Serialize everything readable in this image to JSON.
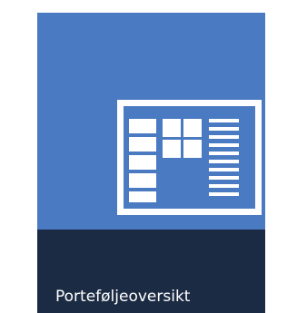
{
  "tile": {
    "label": "Porteføljeoversikt",
    "icon": "portfolio-overview-icon"
  },
  "colors": {
    "tile_background": "#4a7bc2",
    "footer_background": "#1c2b44",
    "icon_foreground": "#ffffff"
  }
}
